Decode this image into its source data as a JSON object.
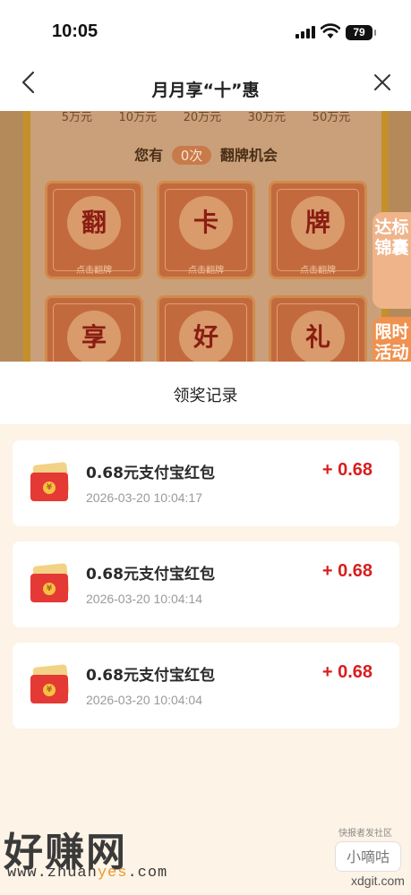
{
  "status_bar": {
    "time": "10:05",
    "battery": "79"
  },
  "nav": {
    "title": "月月享“十”惠",
    "back_icon": "chevron-left-icon",
    "close_icon": "close-icon"
  },
  "background": {
    "amounts": [
      "5万元",
      "10万元",
      "20万元",
      "30万元",
      "50万元"
    ],
    "chance_prefix": "您有",
    "chance_count": "0次",
    "chance_suffix": "翻牌机会",
    "cards": [
      {
        "char": "翻",
        "tip": "点击翻牌"
      },
      {
        "char": "卡",
        "tip": "点击翻牌"
      },
      {
        "char": "牌",
        "tip": "点击翻牌"
      },
      {
        "char": "享",
        "tip": ""
      },
      {
        "char": "好",
        "tip": ""
      },
      {
        "char": "礼",
        "tip": ""
      }
    ]
  },
  "side_tabs": {
    "top": "达标锦囊",
    "bottom": "限时活动"
  },
  "panel": {
    "title": "领奖记录",
    "records": [
      {
        "name": "0.68元支付宝红包",
        "time": "2026-03-20 10:04:17",
        "amount": "+ 0.68"
      },
      {
        "name": "0.68元支付宝红包",
        "time": "2026-03-20 10:04:14",
        "amount": "+ 0.68"
      },
      {
        "name": "0.68元支付宝红包",
        "time": "2026-03-20 10:04:04",
        "amount": "+ 0.68"
      }
    ]
  },
  "watermarks": {
    "left_text": "好赚网",
    "left_url_a": "www.zhuan",
    "left_url_b": "yes",
    "left_url_c": ".com",
    "right_label": "快报者发社区",
    "right_box": "小嘀咕",
    "right_url": "xdgit.com"
  }
}
